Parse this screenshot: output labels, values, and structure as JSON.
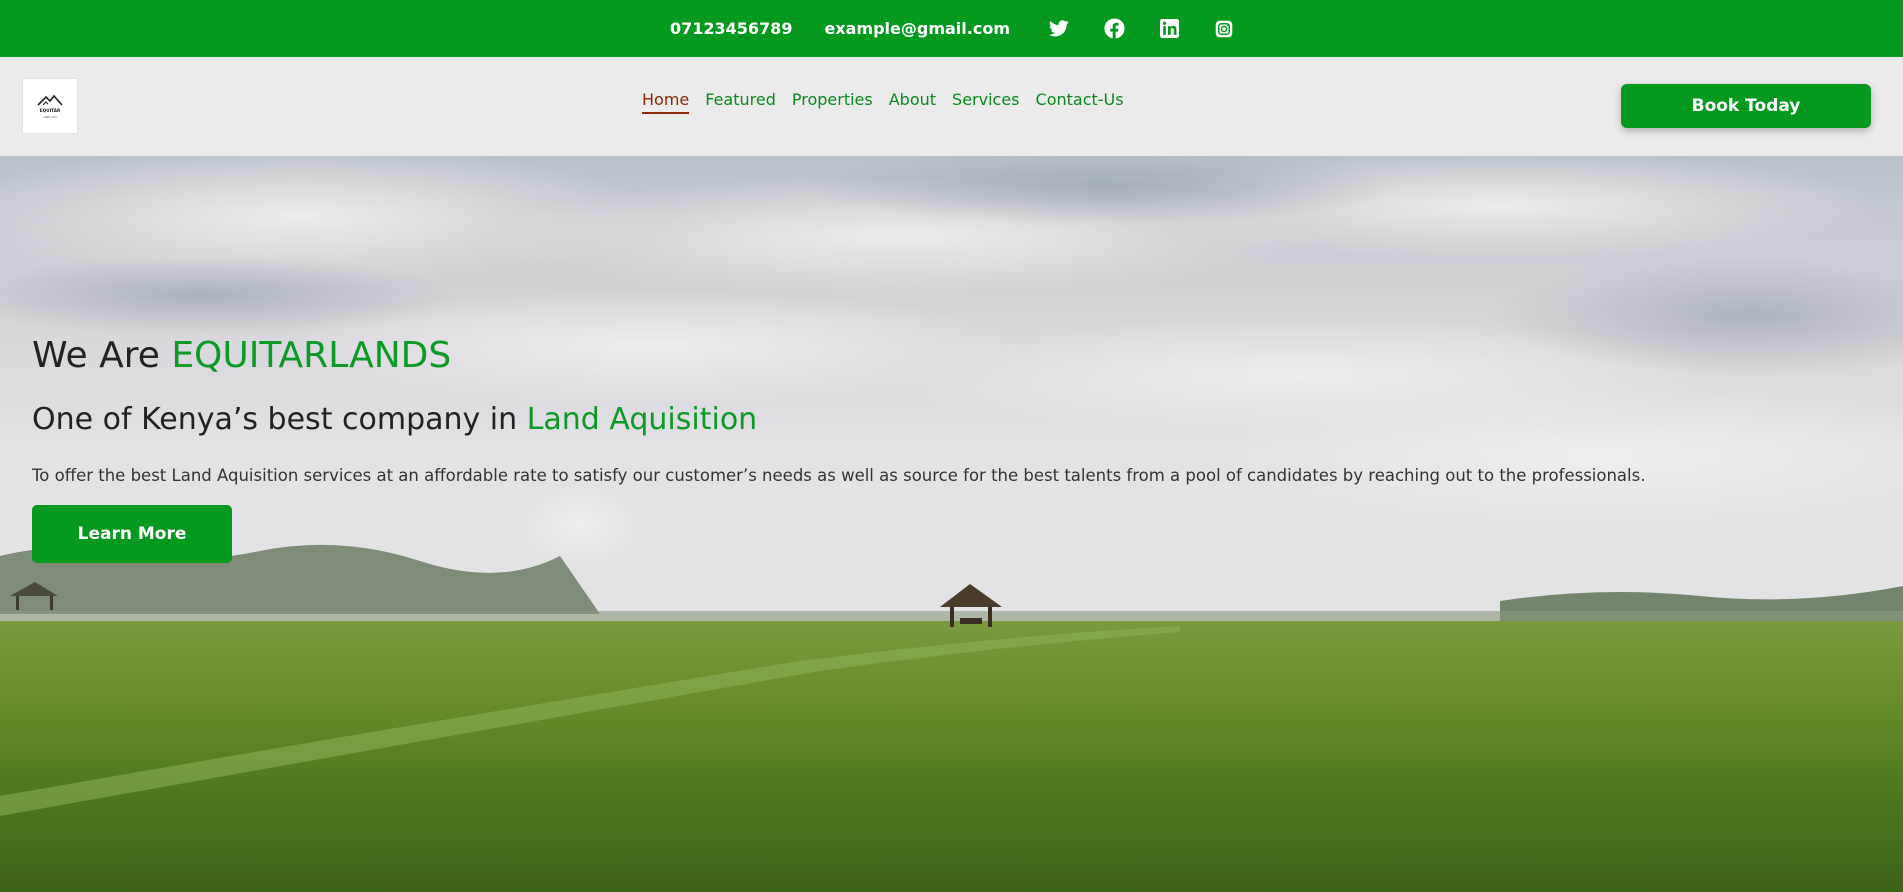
{
  "topbar": {
    "phone": "07123456789",
    "email": "example@gmail.com",
    "social": [
      {
        "icon": "twitter-icon"
      },
      {
        "icon": "facebook-icon"
      },
      {
        "icon": "linkedin-icon"
      },
      {
        "icon": "instagram-icon"
      }
    ]
  },
  "header": {
    "logo_text": "EQUITAR",
    "logo_subtext": "LAND AQU",
    "nav": [
      {
        "label": "Home",
        "active": true
      },
      {
        "label": "Featured"
      },
      {
        "label": "Properties"
      },
      {
        "label": "About"
      },
      {
        "label": "Services"
      },
      {
        "label": "Contact-Us"
      }
    ],
    "cta_label": "Book Today"
  },
  "hero": {
    "title_prefix": "We Are ",
    "title_highlight": "EQUITARLANDS",
    "subtitle_prefix": "One of Kenya’s best company in ",
    "subtitle_highlight": "Land Aquisition",
    "description": "To offer the best Land Aquisition services at an affordable rate to satisfy our customer’s needs as well as source for the best talents from a pool of candidates by reaching out to the professionals.",
    "button_label": "Learn More"
  },
  "colors": {
    "brand_green": "#05991f",
    "nav_green": "#0a8a1e",
    "active_nav": "#8b2a07",
    "header_bg": "#ebebeb"
  }
}
